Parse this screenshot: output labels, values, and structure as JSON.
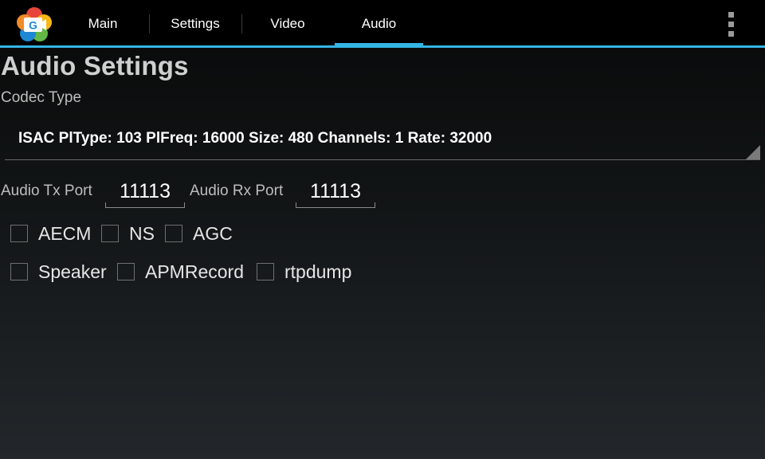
{
  "action_bar": {
    "tabs": [
      {
        "label": "Main",
        "selected": false
      },
      {
        "label": "Settings",
        "selected": false
      },
      {
        "label": "Video",
        "selected": false
      },
      {
        "label": "Audio",
        "selected": true
      }
    ],
    "logo_icon": "webrtc-logo-icon",
    "overflow_icon": "overflow-menu-icon",
    "accent_color": "#33b5e5"
  },
  "page": {
    "title": "Audio Settings",
    "codec_label": "Codec Type",
    "codec_value": "ISAC PlType: 103 PlFreq: 16000 Size: 480 Channels: 1 Rate: 32000",
    "tx_port_label": "Audio Tx Port",
    "tx_port_value": "11113",
    "rx_port_label": "Audio Rx Port",
    "rx_port_value": "11113",
    "checkboxes_row1": [
      {
        "label": "AECM",
        "checked": false
      },
      {
        "label": "NS",
        "checked": false
      },
      {
        "label": "AGC",
        "checked": false
      }
    ],
    "checkboxes_row2": [
      {
        "label": "Speaker",
        "checked": false
      },
      {
        "label": "APMRecord",
        "checked": false
      },
      {
        "label": "rtpdump",
        "checked": false
      }
    ]
  }
}
